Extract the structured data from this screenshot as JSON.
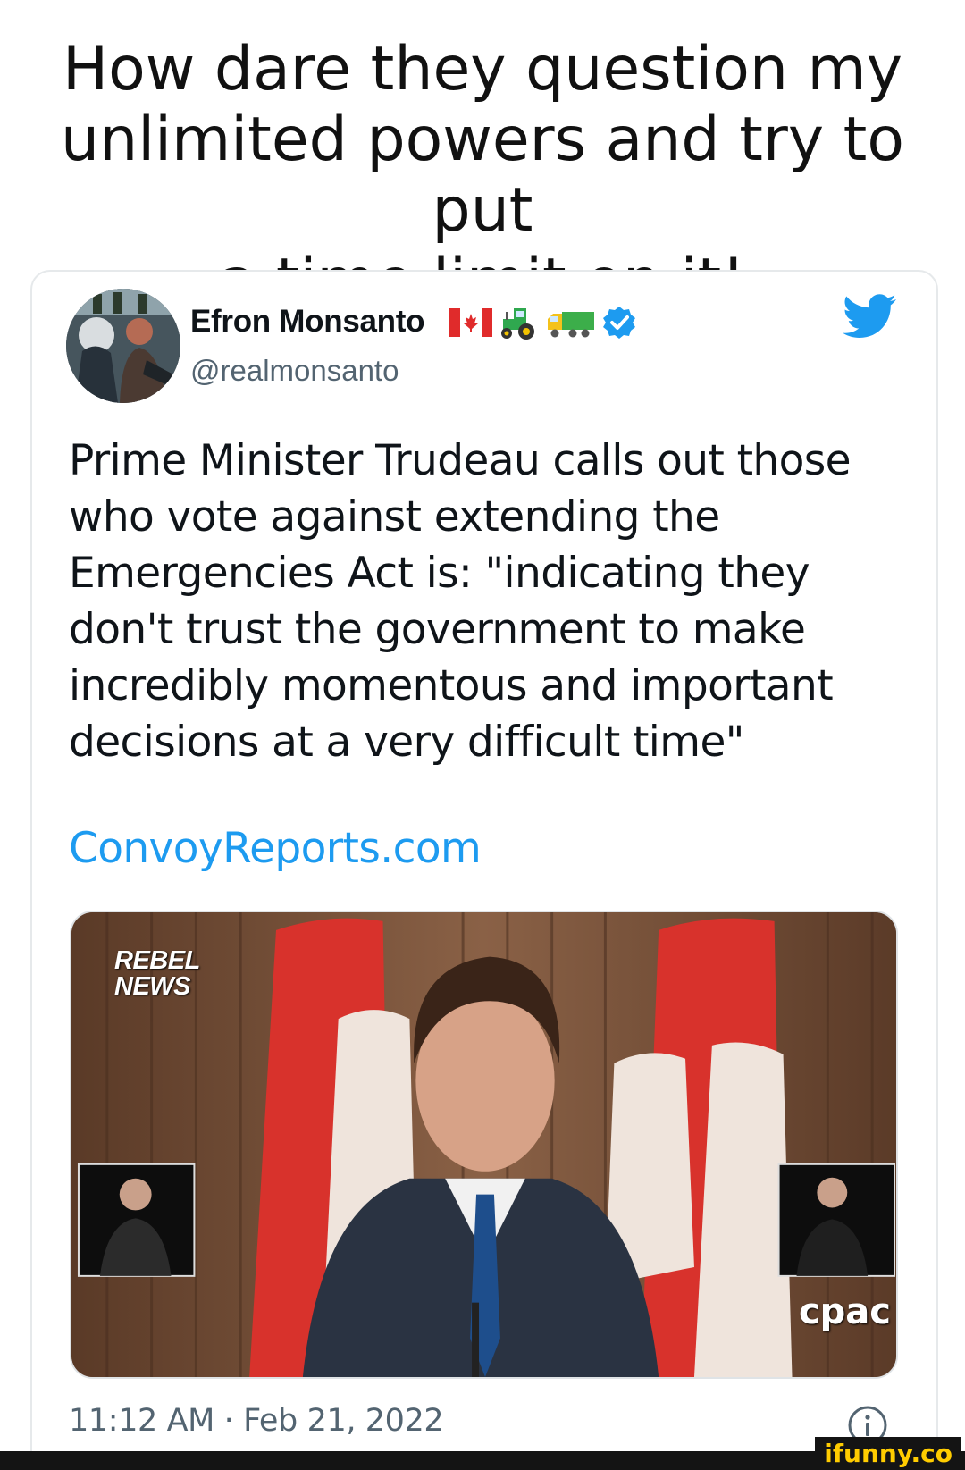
{
  "caption": {
    "lines": [
      "How dare they question my",
      "unlimited powers and try to put",
      "a time limit on it!"
    ]
  },
  "tweet": {
    "author": {
      "name": "Efron Monsanto",
      "handle": "@realmonsanto",
      "emojis": [
        "canada-flag-icon",
        "tractor-icon",
        "truck-icon",
        "verified-badge-icon"
      ]
    },
    "text_lines": [
      "Prime Minister Trudeau calls out those",
      "who vote against extending the",
      "Emergencies Act is: \"indicating they",
      "don't trust the government to make",
      "incredibly momentous and important",
      "decisions at a very difficult time\""
    ],
    "link": "ConvoyReports.com",
    "media": {
      "watermark_lines": [
        "REBEL",
        "NEWS"
      ],
      "broadcaster": "cpac"
    },
    "timestamp": "11:12 AM · Feb 21, 2022"
  },
  "footer": {
    "watermark": "ifunny.co"
  },
  "colors": {
    "link": "#1d9bf0",
    "twitter_blue": "#1d9bf0",
    "secondary_text": "#536471",
    "canada_red": "#e02b2b"
  }
}
